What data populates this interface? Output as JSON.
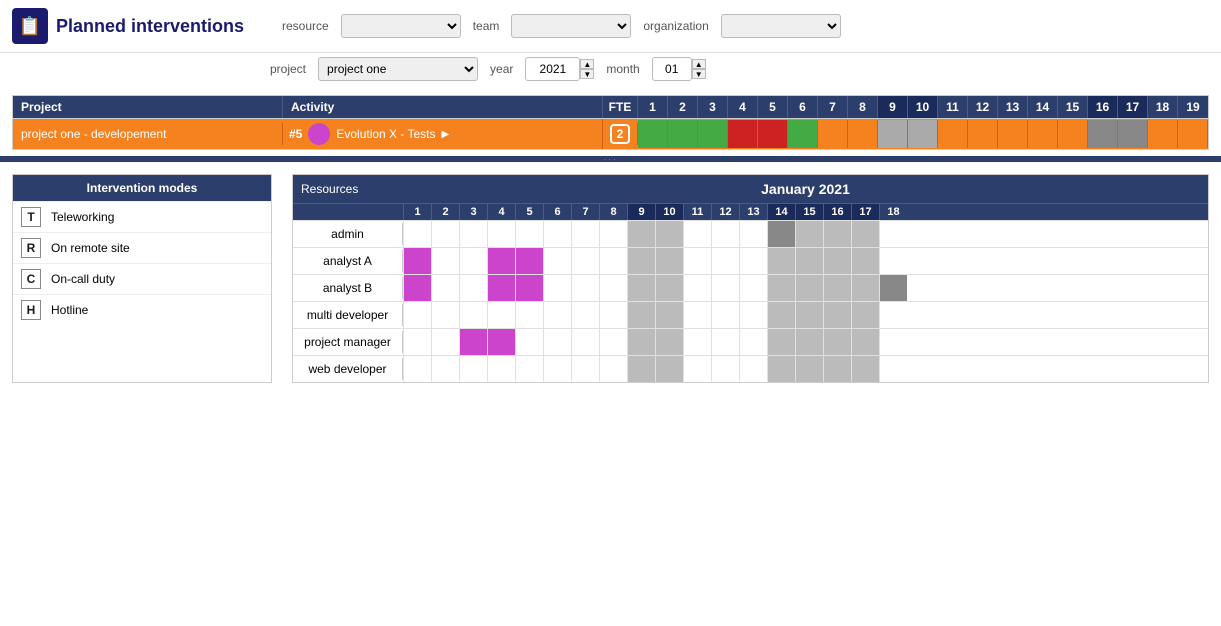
{
  "app": {
    "title": "Planned interventions",
    "logo": "📋"
  },
  "filters": {
    "resource_label": "resource",
    "team_label": "team",
    "organization_label": "organization",
    "project_label": "project",
    "year_label": "year",
    "month_label": "month",
    "project_value": "project one",
    "year_value": "2021",
    "month_value": "01"
  },
  "gantt": {
    "headers": {
      "project": "Project",
      "activity": "Activity",
      "fte": "FTE"
    },
    "days": [
      "1",
      "2",
      "3",
      "4",
      "5",
      "6",
      "7",
      "8",
      "9",
      "10",
      "11",
      "12",
      "13",
      "14",
      "15",
      "16",
      "17",
      "18",
      "19"
    ],
    "row": {
      "project": "project one - developement",
      "activity_id": "#5",
      "activity_name": "Evolution X - Tests",
      "fte": "2",
      "day_states": [
        "green",
        "green",
        "green",
        "red",
        "red",
        "green",
        "empty",
        "empty",
        "gray",
        "gray",
        "empty",
        "empty",
        "empty",
        "empty",
        "empty",
        "dark",
        "dark",
        "empty",
        "empty"
      ]
    }
  },
  "legend": {
    "title": "Intervention modes",
    "items": [
      {
        "letter": "T",
        "label": "Teleworking"
      },
      {
        "letter": "R",
        "label": "On remote site"
      },
      {
        "letter": "C",
        "label": "On-call duty"
      },
      {
        "letter": "H",
        "label": "Hotline"
      }
    ]
  },
  "resources": {
    "month_label": "January 2021",
    "col_label": "Resources",
    "days": [
      "1",
      "2",
      "3",
      "4",
      "5",
      "6",
      "7",
      "8",
      "9",
      "10",
      "11",
      "12",
      "13",
      "14",
      "15",
      "16",
      "17",
      "18"
    ],
    "rows": [
      {
        "name": "admin",
        "cells": [
          "w",
          "w",
          "w",
          "w",
          "w",
          "w",
          "w",
          "w",
          "w",
          "w",
          "w",
          "w",
          "w",
          "dg",
          "w",
          "w",
          "w",
          "w"
        ]
      },
      {
        "name": "analyst A",
        "cells": [
          "m",
          "w",
          "w",
          "m",
          "m",
          "w",
          "w",
          "w",
          "w",
          "w",
          "w",
          "w",
          "w",
          "w",
          "w",
          "g",
          "w",
          "w"
        ]
      },
      {
        "name": "analyst B",
        "cells": [
          "m",
          "w",
          "w",
          "m",
          "m",
          "w",
          "w",
          "w",
          "w",
          "w",
          "w",
          "w",
          "w",
          "w",
          "w",
          "w",
          "w",
          "dg"
        ]
      },
      {
        "name": "multi developer",
        "cells": [
          "w",
          "w",
          "w",
          "w",
          "w",
          "w",
          "w",
          "w",
          "w",
          "w",
          "w",
          "w",
          "w",
          "w",
          "w",
          "g",
          "w",
          "w"
        ]
      },
      {
        "name": "project manager",
        "cells": [
          "w",
          "w",
          "m",
          "m",
          "w",
          "w",
          "w",
          "w",
          "w",
          "w",
          "w",
          "w",
          "w",
          "w",
          "w",
          "g",
          "w",
          "w"
        ]
      },
      {
        "name": "web developer",
        "cells": [
          "w",
          "w",
          "w",
          "w",
          "w",
          "w",
          "w",
          "w",
          "w",
          "w",
          "w",
          "w",
          "w",
          "w",
          "w",
          "g",
          "w",
          "w"
        ]
      }
    ]
  }
}
